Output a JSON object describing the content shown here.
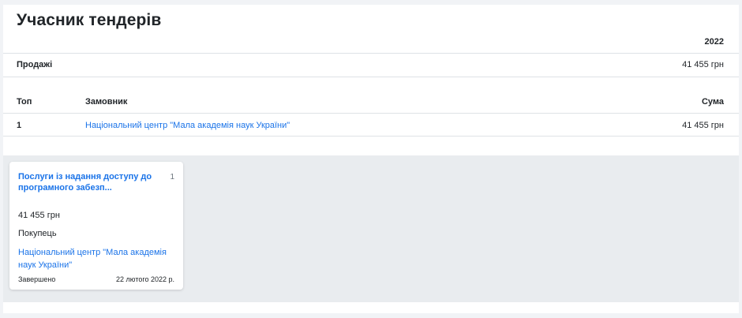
{
  "page": {
    "title": "Учасник тендерів"
  },
  "summary": {
    "year": "2022",
    "sales_label": "Продажі",
    "sales_value": "41 455 грн"
  },
  "top_table": {
    "headers": {
      "rank": "Топ",
      "customer": "Замовник",
      "sum": "Сума"
    },
    "rows": [
      {
        "rank": "1",
        "customer": "Національний центр \"Мала академія наук України\"",
        "sum": "41 455 грн"
      }
    ]
  },
  "cards": [
    {
      "title": "Послуги із надання доступу до програмного забезп...",
      "count": "1",
      "amount": "41 455 грн",
      "role": "Покупець",
      "customer": "Національний центр \"Мала академія наук України\"",
      "status": "Завершено",
      "date": "22 лютого 2022 р."
    }
  ]
}
